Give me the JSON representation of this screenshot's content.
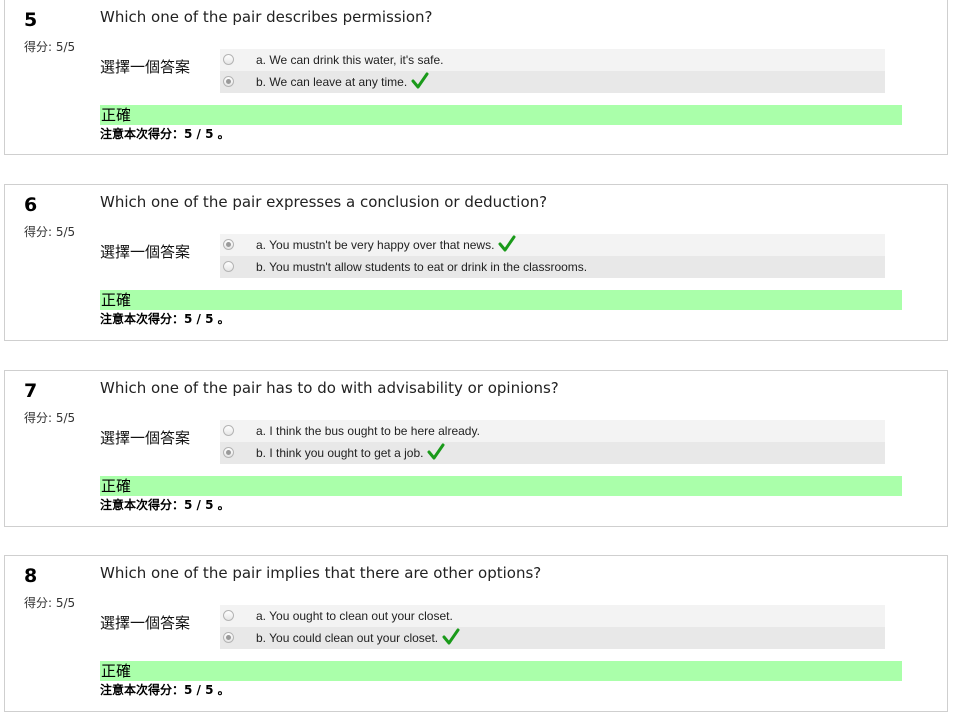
{
  "questions": [
    {
      "number": "5",
      "grade": "得分: 5/5",
      "text": "Which one of the pair describes permission?",
      "prompt": "選擇一個答案",
      "options": [
        {
          "label": "a. We can drink this water, it's safe.",
          "selected": false,
          "correct": false
        },
        {
          "label": "b. We can leave at any time.",
          "selected": true,
          "correct": true
        }
      ],
      "feedback": "正確",
      "note": "注意本次得分：5 / 5 。"
    },
    {
      "number": "6",
      "grade": "得分: 5/5",
      "text": "Which one of the pair expresses a conclusion or deduction?",
      "prompt": "選擇一個答案",
      "options": [
        {
          "label": "a. You mustn't be very happy over that news.",
          "selected": true,
          "correct": true
        },
        {
          "label": "b. You mustn't allow students to eat or drink in the classrooms.",
          "selected": false,
          "correct": false
        }
      ],
      "feedback": "正確",
      "note": "注意本次得分：5 / 5 。"
    },
    {
      "number": "7",
      "grade": "得分: 5/5",
      "text": "Which one of the pair has to do with advisability or opinions?",
      "prompt": "選擇一個答案",
      "options": [
        {
          "label": "a. I think the bus ought to be here already.",
          "selected": false,
          "correct": false
        },
        {
          "label": "b. I think you ought to get a job.",
          "selected": true,
          "correct": true
        }
      ],
      "feedback": "正確",
      "note": "注意本次得分：5 / 5 。"
    },
    {
      "number": "8",
      "grade": "得分: 5/5",
      "text": "Which one of the pair implies that there are other options?",
      "prompt": "選擇一個答案",
      "options": [
        {
          "label": "a. You ought to clean out your closet.",
          "selected": false,
          "correct": false
        },
        {
          "label": "b. You could clean out your closet.",
          "selected": true,
          "correct": true
        }
      ],
      "feedback": "正確",
      "note": "注意本次得分：5 / 5 。"
    }
  ],
  "colors": {
    "feedback_bg": "#aaffaa",
    "check_color": "#1a9a1a",
    "border": "#cfcfcf"
  },
  "icons": {
    "correct": "checkmark-icon",
    "radio": "radio-button"
  }
}
